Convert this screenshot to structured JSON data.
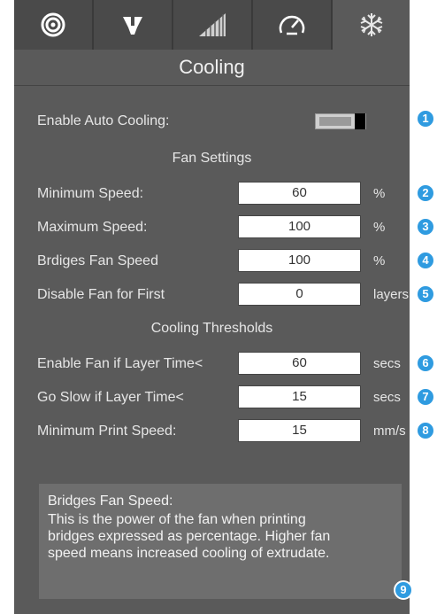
{
  "tabs": [
    {
      "icon": "spiral-icon"
    },
    {
      "icon": "nozzle-icon"
    },
    {
      "icon": "layers-icon"
    },
    {
      "icon": "speedometer-icon"
    },
    {
      "icon": "snowflake-icon",
      "active": true
    }
  ],
  "title": "Cooling",
  "auto_cooling": {
    "label": "Enable Auto Cooling:",
    "enabled": true
  },
  "fan_settings": {
    "heading": "Fan Settings",
    "rows": [
      {
        "label": "Minimum Speed:",
        "value": "60",
        "unit": "%"
      },
      {
        "label": "Maximum Speed:",
        "value": "100",
        "unit": "%"
      },
      {
        "label": "Brdiges Fan Speed",
        "value": "100",
        "unit": "%"
      },
      {
        "label": "Disable Fan for First",
        "value": "0",
        "unit": "layers"
      }
    ]
  },
  "thresholds": {
    "heading": "Cooling Thresholds",
    "rows": [
      {
        "label": "Enable Fan if Layer Time<",
        "value": "60",
        "unit": "secs"
      },
      {
        "label": "Go Slow if Layer Time<",
        "value": "15",
        "unit": "secs"
      },
      {
        "label": "Minimum Print Speed:",
        "value": "15",
        "unit": "mm/s"
      }
    ]
  },
  "info": {
    "heading": "Bridges Fan Speed:",
    "lines": [
      "This is the power of the fan when printing",
      "bridges expressed as percentage. Higher fan",
      "speed means increased cooling of extrudate."
    ]
  },
  "badges": [
    "1",
    "2",
    "3",
    "4",
    "5",
    "6",
    "7",
    "8",
    "9"
  ],
  "colors": {
    "panel": "#5a5a5a",
    "tabbar": "#4a4a4a",
    "badge": "#2f9be0"
  }
}
